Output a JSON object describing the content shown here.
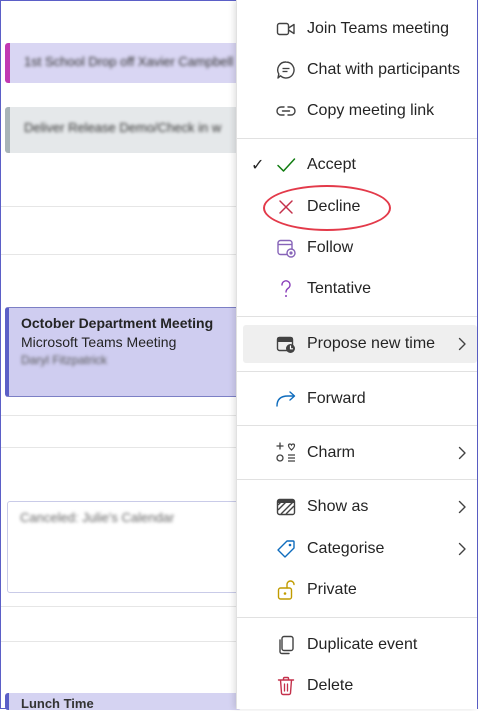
{
  "calendar": {
    "event_1": "1st School Drop off Xavier Campbell",
    "event_2": "Deliver Release Demo/Check in w",
    "meeting": {
      "title": "October Department Meeting",
      "subtitle": "Microsoft Teams Meeting",
      "organizer": "Daryl Fitzpatrick"
    },
    "event_4": "Canceled: Julie's Calendar",
    "event_5": "Lunch Time"
  },
  "menu": {
    "join": "Join Teams meeting",
    "chat": "Chat with participants",
    "copy_link": "Copy meeting link",
    "accept": "Accept",
    "accept_check": "✓",
    "decline": "Decline",
    "follow": "Follow",
    "tentative": "Tentative",
    "propose": "Propose new time",
    "forward": "Forward",
    "charm": "Charm",
    "show_as": "Show as",
    "categorise": "Categorise",
    "private": "Private",
    "duplicate": "Duplicate event",
    "delete": "Delete"
  },
  "colors": {
    "accept_green": "#107c10",
    "decline_red": "#c4314b",
    "follow_purple": "#8764b8",
    "tentative_purple": "#8a3fba",
    "forward_blue": "#0f6cbd",
    "private_gold": "#c19c00",
    "callout_red": "#e33a4a"
  },
  "icons": {
    "join": "video-camera-icon",
    "chat": "chat-bubble-icon",
    "copy_link": "link-icon",
    "accept": "checkmark-icon",
    "decline": "x-icon",
    "follow": "calendar-follow-icon",
    "tentative": "question-mark-icon",
    "propose": "calendar-clock-icon",
    "forward": "forward-arrow-icon",
    "charm": "charm-icon",
    "show_as": "show-as-icon",
    "categorise": "tag-icon",
    "private": "lock-open-icon",
    "duplicate": "copy-icon",
    "delete": "trash-icon"
  }
}
